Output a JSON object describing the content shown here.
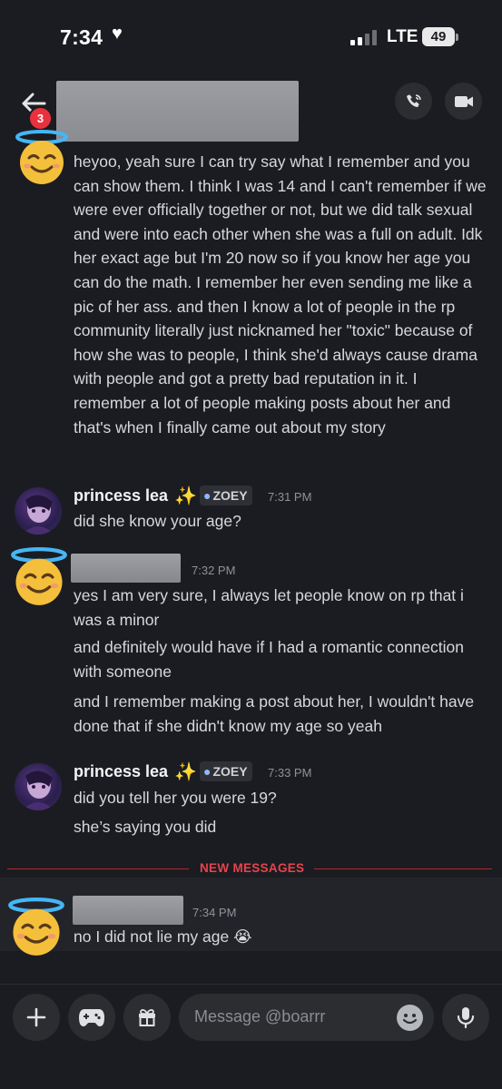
{
  "status": {
    "time": "7:34",
    "network": "LTE",
    "battery": "49"
  },
  "header": {
    "unread_count": "3"
  },
  "messages": [
    {
      "text": "heyoo, yeah sure I can try say what I remember and you can show them. I think I was 14 and I can't remember if we were ever officially together or not, but we did talk sexual and were into each other when she was a full on adult. Idk her exact age but I'm 20 now so if you know her age you can do the math. I remember her even sending me like a pic of her ass. and then I know a lot of people in the rp community literally just nicknamed her \"toxic\" because of how she was to people, I think she'd always cause drama with people and got a pretty bad reputation in it. I remember a lot of people making posts about her and that's when I finally came out about my story"
    },
    {
      "author": "princess lea",
      "sparkle": "✨",
      "tag": "ZOEY",
      "time": "7:31 PM",
      "lines": [
        "did she know your age?"
      ]
    },
    {
      "time": "7:32 PM",
      "lines": [
        "yes I am very sure, I always let people know on rp that i was a minor",
        "and definitely would have if I had a romantic connection with someone",
        "and I remember making a post about her, I wouldn't have done that if she didn't know my age so yeah"
      ]
    },
    {
      "author": "princess lea",
      "sparkle": "✨",
      "tag": "ZOEY",
      "time": "7:33 PM",
      "lines": [
        "did you tell her you were 19?",
        "she’s saying you did"
      ]
    },
    {
      "time": "7:34 PM",
      "lines": [
        "no I did not lie my age 😭"
      ]
    }
  ],
  "new_messages_label": "NEW MESSAGES",
  "composer": {
    "placeholder": "Message @boarrr"
  },
  "colors": {
    "background": "#1b1c21",
    "new_messages": "#e7434d",
    "badge": "#e8313d"
  }
}
